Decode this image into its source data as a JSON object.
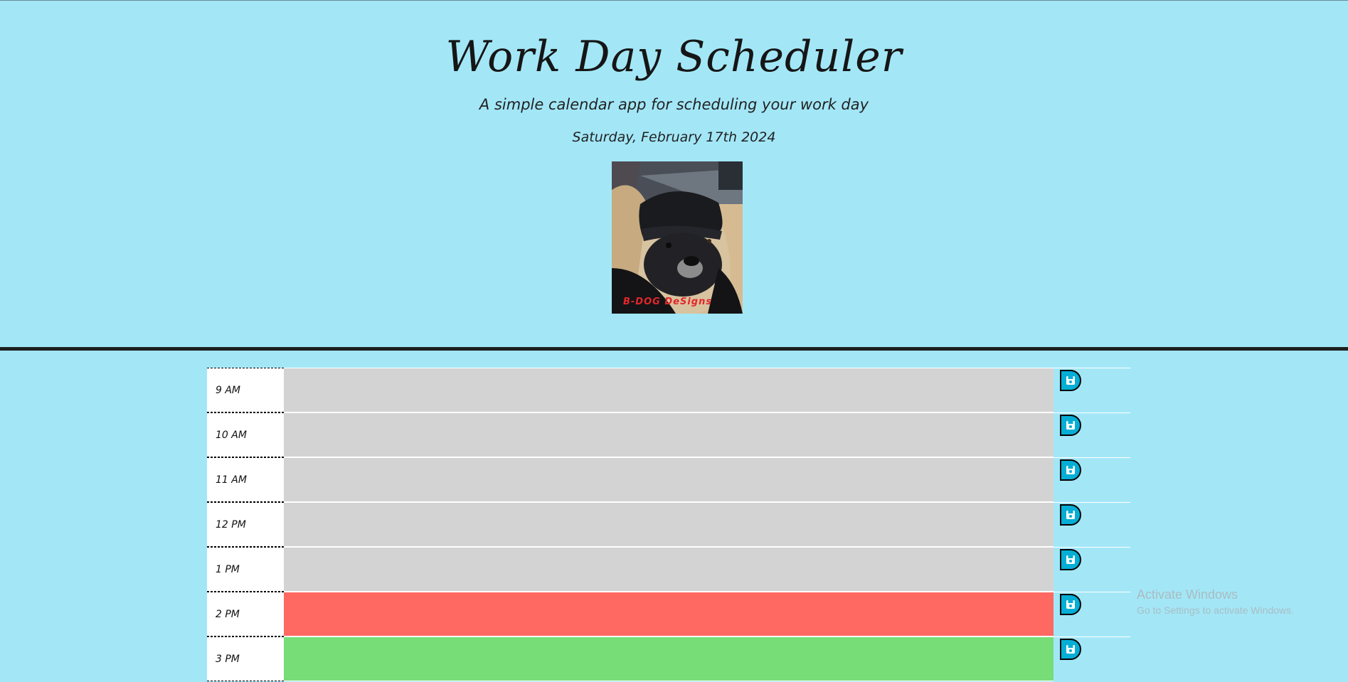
{
  "header": {
    "title": "Work Day Scheduler",
    "subtitle": "A simple calendar app for scheduling your work day",
    "current_day": "Saturday, February 17th 2024",
    "logo_caption": "B-DOG DeSigns"
  },
  "schedule": {
    "rows": [
      {
        "hour": "9 AM",
        "status": "past",
        "text": ""
      },
      {
        "hour": "10 AM",
        "status": "past",
        "text": ""
      },
      {
        "hour": "11 AM",
        "status": "past",
        "text": ""
      },
      {
        "hour": "12 PM",
        "status": "past",
        "text": ""
      },
      {
        "hour": "1 PM",
        "status": "past",
        "text": ""
      },
      {
        "hour": "2 PM",
        "status": "present",
        "text": ""
      },
      {
        "hour": "3 PM",
        "status": "future",
        "text": ""
      }
    ],
    "save_icon": "floppy-disk-icon"
  },
  "colors": {
    "background": "#a3e7f7",
    "past": "#d3d3d3",
    "present": "#ff6961",
    "future": "#77dd77",
    "save_button": "#06aed5"
  },
  "watermark": {
    "line1": "Activate Windows",
    "line2": "Go to Settings to activate Windows."
  }
}
